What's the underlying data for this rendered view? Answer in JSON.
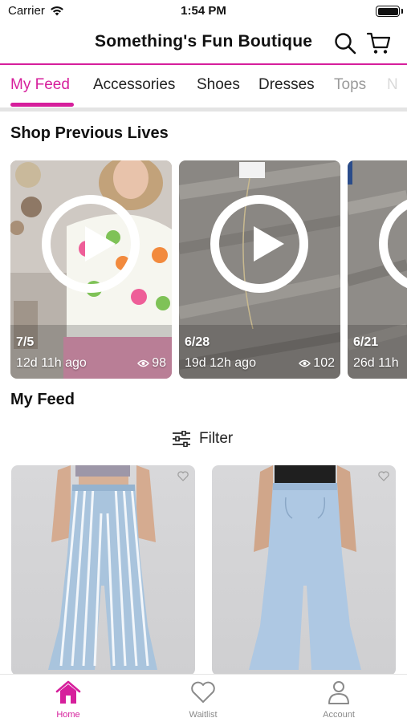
{
  "status_bar": {
    "carrier": "Carrier",
    "time": "1:54 PM"
  },
  "header": {
    "title": "Something's Fun Boutique",
    "search_icon": "search-icon",
    "cart_icon": "cart-icon"
  },
  "tabs": [
    {
      "label": "My Feed",
      "active": true
    },
    {
      "label": "Accessories"
    },
    {
      "label": "Shoes"
    },
    {
      "label": "Dresses"
    },
    {
      "label": "Tops"
    },
    {
      "label": "N"
    }
  ],
  "previous_lives": {
    "title": "Shop Previous Lives",
    "items": [
      {
        "date": "7/5",
        "ago": "12d 11h ago",
        "views": "98"
      },
      {
        "date": "6/28",
        "ago": "19d 12h ago",
        "views": "102"
      },
      {
        "date": "6/21",
        "ago": "26d 11h",
        "views": ""
      }
    ]
  },
  "feed": {
    "title": "My Feed",
    "filter_label": "Filter",
    "products": [
      {
        "name": "striped-flare-jeans",
        "favorite": false
      },
      {
        "name": "light-wash-flare-jeans",
        "favorite": false
      }
    ]
  },
  "bottom_nav": [
    {
      "label": "Home",
      "icon": "home-icon",
      "active": true
    },
    {
      "label": "Waitlist",
      "icon": "heart-icon"
    },
    {
      "label": "Account",
      "icon": "user-icon"
    }
  ],
  "colors": {
    "accent": "#d61f9c",
    "inactive": "#8a8a8a",
    "divider": "#e4e4e4"
  }
}
